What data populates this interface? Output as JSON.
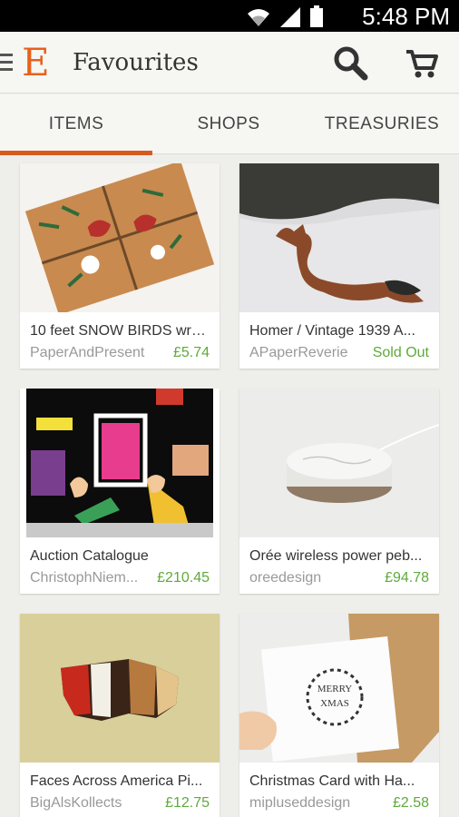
{
  "status_bar": {
    "time": "5:48 PM",
    "icons": [
      "wifi-icon",
      "signal-icon",
      "battery-icon"
    ]
  },
  "app_bar": {
    "logo": "E",
    "title": "Favourites"
  },
  "tabs": [
    {
      "label": "ITEMS",
      "active": true
    },
    {
      "label": "SHOPS",
      "active": false
    },
    {
      "label": "TREASURIES",
      "active": false
    }
  ],
  "items": [
    {
      "title": "10 feet SNOW BIRDS wra...",
      "shop": "PaperAndPresent",
      "price": "£5.74"
    },
    {
      "title": "Homer  / Vintage 1939 A...",
      "shop": "APaperReverie",
      "price": "Sold Out"
    },
    {
      "title": "Auction Catalogue",
      "shop": "ChristophNiem...",
      "price": "£210.45"
    },
    {
      "title": "Orée wireless power peb...",
      "shop": "oreedesign",
      "price": "£94.78"
    },
    {
      "title": "Faces Across America Pi...",
      "shop": "BigAlsKollects",
      "price": "£12.75"
    },
    {
      "title": "Christmas Card with Ha...",
      "shop": "mipluseddesign",
      "price": "£2.58"
    }
  ],
  "card_images": {
    "card5_text_1": "MERRY",
    "card5_text_2": "XMAS"
  },
  "colors": {
    "accent": "#d55b1f",
    "logo": "#e8611a",
    "price": "#5eaa3a"
  }
}
